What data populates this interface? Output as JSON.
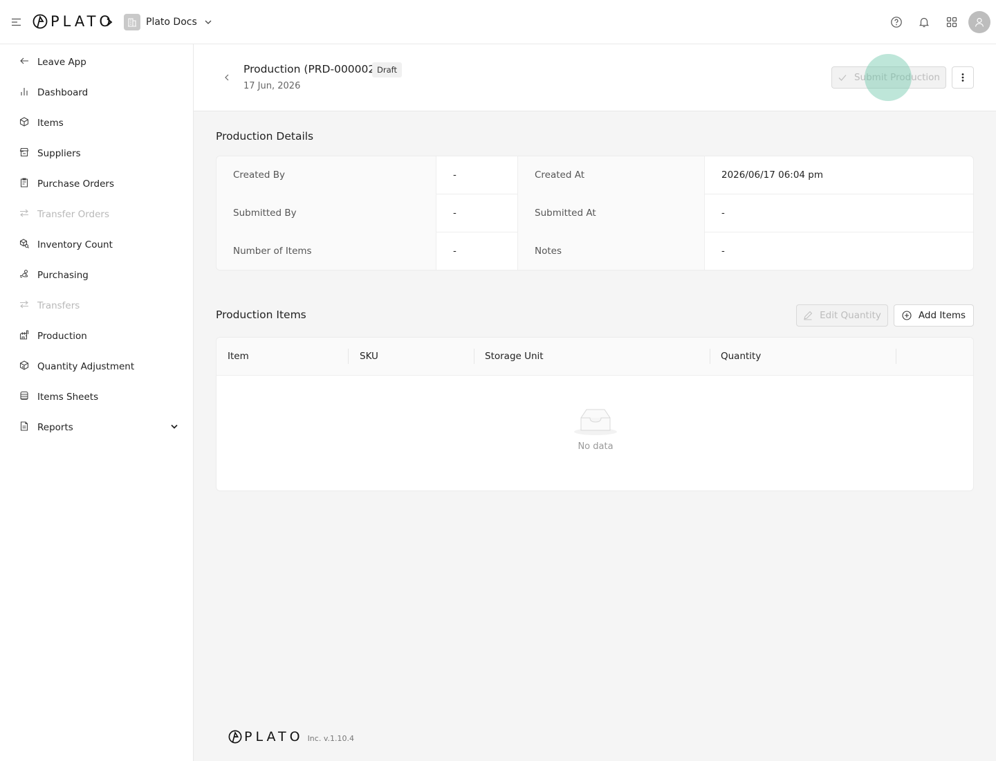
{
  "topbar": {
    "brand": "PLATO",
    "workspace_name": "Plato Docs"
  },
  "sidebar": {
    "items": [
      {
        "label": "Leave App",
        "icon": "arrow-left-icon",
        "disabled": false
      },
      {
        "label": "Dashboard",
        "icon": "bar-chart-icon",
        "disabled": false
      },
      {
        "label": "Items",
        "icon": "box-icon",
        "disabled": false
      },
      {
        "label": "Suppliers",
        "icon": "store-icon",
        "disabled": false
      },
      {
        "label": "Purchase Orders",
        "icon": "clipboard-icon",
        "disabled": false
      },
      {
        "label": "Transfer Orders",
        "icon": "transfer-icon",
        "disabled": true
      },
      {
        "label": "Inventory Count",
        "icon": "count-icon",
        "disabled": false
      },
      {
        "label": "Purchasing",
        "icon": "purchasing-icon",
        "disabled": false
      },
      {
        "label": "Transfers",
        "icon": "transfer-icon",
        "disabled": true
      },
      {
        "label": "Production",
        "icon": "production-icon",
        "disabled": false
      },
      {
        "label": "Quantity Adjustment",
        "icon": "adjust-icon",
        "disabled": false
      },
      {
        "label": "Items Sheets",
        "icon": "sheets-icon",
        "disabled": false
      },
      {
        "label": "Reports",
        "icon": "report-icon",
        "disabled": false,
        "expandable": true
      }
    ]
  },
  "page": {
    "title": "Production (PRD-000002)",
    "status": "Draft",
    "date": "17 Jun, 2026",
    "submit_label": "Submit Production"
  },
  "details": {
    "section_title": "Production Details",
    "rows": [
      {
        "l1": "Created By",
        "v1": "-",
        "l2": "Created At",
        "v2": "2026/06/17 06:04 pm"
      },
      {
        "l1": "Submitted By",
        "v1": "-",
        "l2": "Submitted At",
        "v2": "-"
      },
      {
        "l1": "Number of Items",
        "v1": "-",
        "l2": "Notes",
        "v2": "-"
      }
    ]
  },
  "items": {
    "section_title": "Production Items",
    "edit_label": "Edit Quantity",
    "add_label": "Add Items",
    "columns": [
      "Item",
      "SKU",
      "Storage Unit",
      "Quantity"
    ],
    "empty_text": "No data"
  },
  "footer": {
    "brand": "PLATO",
    "version": "Inc. v.1.10.4"
  }
}
